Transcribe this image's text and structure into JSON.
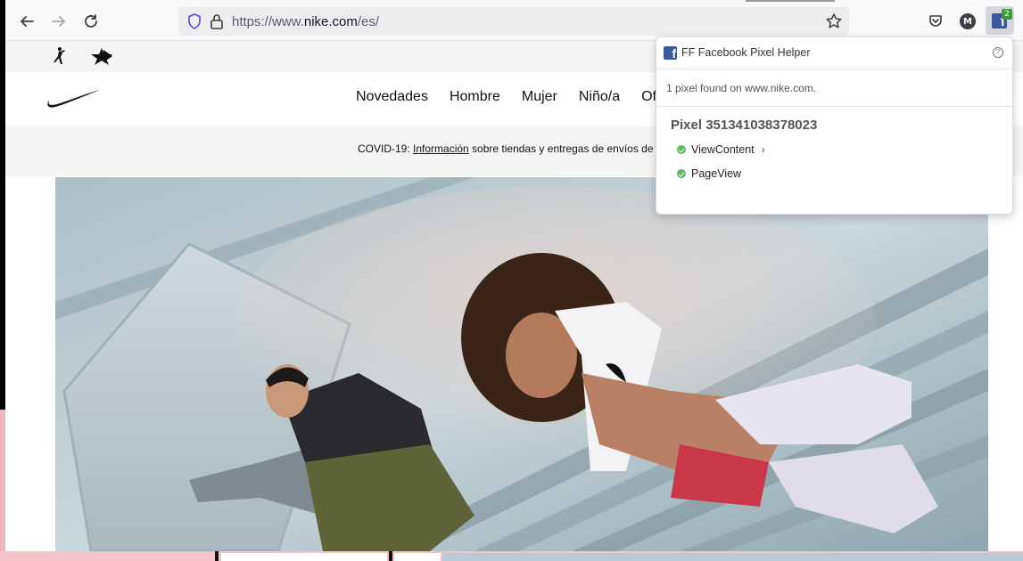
{
  "browser": {
    "url_prefix": "https://www.",
    "url_domain": "nike.com",
    "url_suffix": "/es/",
    "profile_initial": "M",
    "extension_badge": "2"
  },
  "nike": {
    "nav": [
      "Novedades",
      "Hombre",
      "Mujer",
      "Niño/a",
      "Of"
    ],
    "covid_prefix": "COVID-19: ",
    "covid_link": "Información",
    "covid_suffix": " sobre tiendas y entregas de envíos de"
  },
  "popup": {
    "title": "FF Facebook Pixel Helper",
    "found_text": "1 pixel found on www.nike.com.",
    "pixel_title": "Pixel 351341038378023",
    "events": [
      {
        "label": "ViewContent",
        "status": "ok",
        "expandable": true
      },
      {
        "label": "PageView",
        "status": "ok",
        "expandable": false
      }
    ]
  },
  "colors": {
    "facebook_blue": "#3b5998",
    "status_ok": "#5cb85c",
    "badge_green": "#3e9a3a"
  },
  "icons": [
    "back-arrow-icon",
    "forward-arrow-icon",
    "reload-icon",
    "tracking-shield-icon",
    "lock-icon",
    "bookmark-star-icon",
    "pocket-icon",
    "jordan-logo-icon",
    "converse-logo-icon",
    "nike-swoosh-logo"
  ]
}
